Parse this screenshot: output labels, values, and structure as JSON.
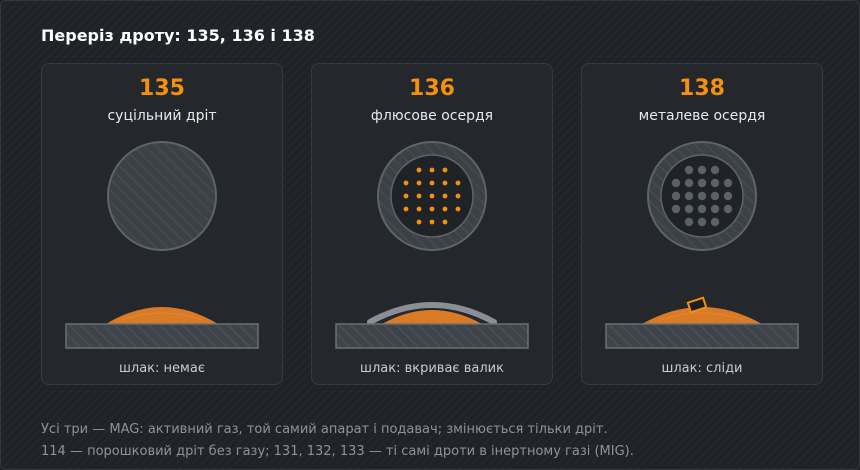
{
  "title": "Переріз дроту: 135, 136 і 138",
  "cards": [
    {
      "code": "135",
      "label": "суцільний дріт",
      "slag": "шлак: немає",
      "type": "solid"
    },
    {
      "code": "136",
      "label": "флюсове осердя",
      "slag": "шлак: вкриває валик",
      "type": "flux"
    },
    {
      "code": "138",
      "label": "металеве осердя",
      "slag": "шлак: сліди",
      "type": "metal"
    }
  ],
  "footer": {
    "line1": "Усі три — MAG: активний газ, той самий апарат і подавач; змінюється тільки дріт.",
    "line2": "114 — порошковий дріт без газу; 131, 132, 133 — ті самі дроти в інертному газі (MIG)."
  },
  "colors": {
    "accent": "#f5900f",
    "flux_dot": "#f5900f",
    "metal_dot": "#5c6167",
    "weld": "#d97a25",
    "plate": "#4a4f55",
    "slag": "#8a8f95"
  }
}
